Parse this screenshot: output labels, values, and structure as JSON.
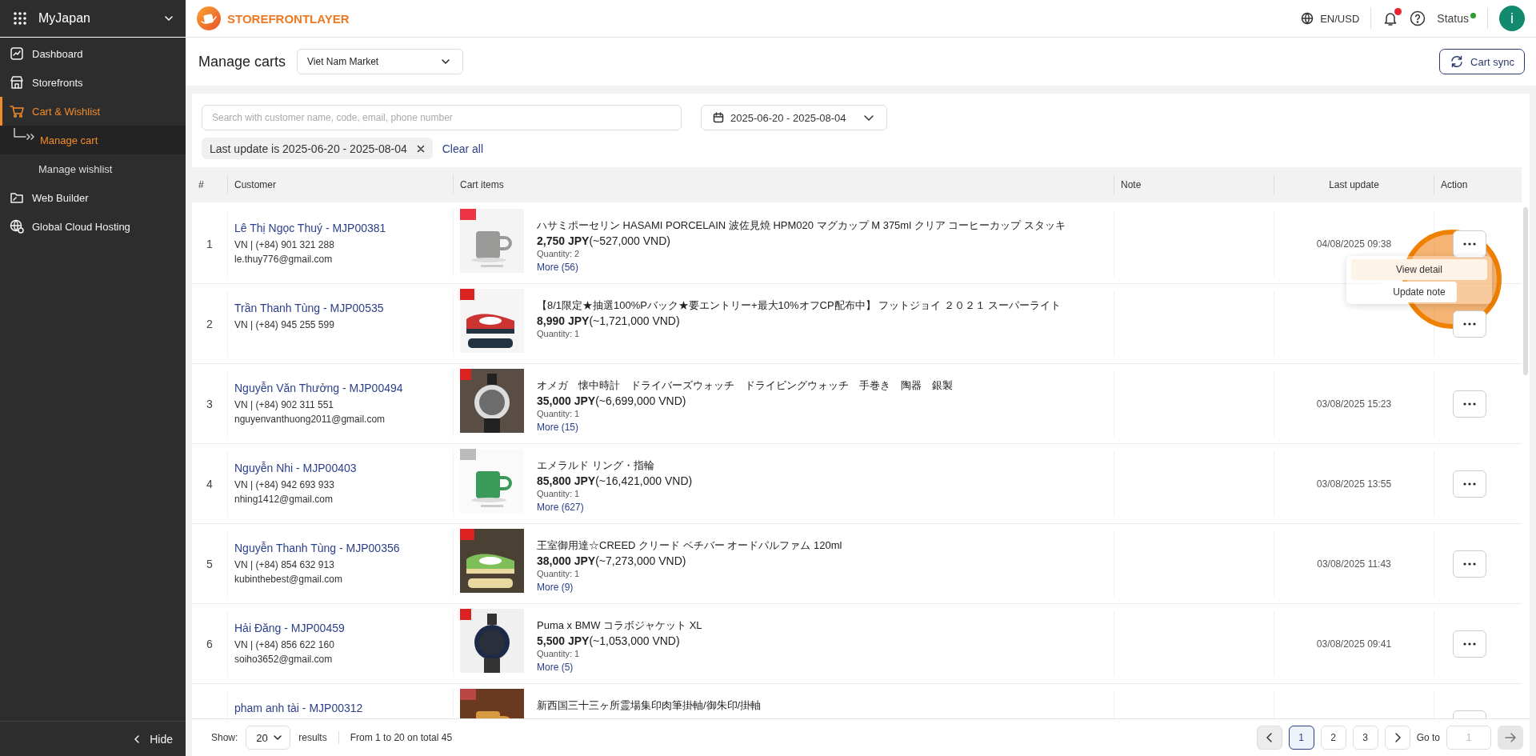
{
  "workspace": {
    "name": "MyJapan"
  },
  "sidebar": {
    "items": [
      {
        "label": "Dashboard",
        "selected": false
      },
      {
        "label": "Storefronts",
        "selected": false
      },
      {
        "label": "Cart & Wishlist",
        "selected": true,
        "children": [
          {
            "label": "Manage cart",
            "selected": true
          },
          {
            "label": "Manage wishlist",
            "selected": false
          }
        ]
      },
      {
        "label": "Web Builder",
        "selected": false
      },
      {
        "label": "Global Cloud Hosting",
        "selected": false
      }
    ],
    "hide_label": "Hide"
  },
  "topbar": {
    "brand": "STOREFRONTLAYER",
    "locale": "EN/USD",
    "notifications_unread": true,
    "status": {
      "label": "Status",
      "online": true
    },
    "avatar": "i"
  },
  "header": {
    "title": "Manage carts",
    "market": "Viet Nam Market",
    "sync_button": "Cart sync"
  },
  "filters": {
    "search_placeholder": "Search with customer name, code, email, phone number",
    "date_range": "2025-06-20 - 2025-08-04",
    "chips": [
      {
        "label": "Last update is 2025-06-20 - 2025-08-04"
      }
    ],
    "clear_all": "Clear all"
  },
  "table": {
    "columns": [
      "#",
      "Customer",
      "Cart items",
      "Note",
      "Last update",
      "Action"
    ],
    "rows": [
      {
        "number": "1",
        "name": "Lê Thị Ngọc Thuý - MJP00381",
        "contact": "VN | (+84) 901 321 288",
        "email": "le.thuy776@gmail.com",
        "item": "ハサミポーセリン HASAMI PORCELAIN 波佐見焼 HPM020 マグカップ M 375ml クリア コーヒーカップ スタッキ",
        "price": "2,750 JPY",
        "converted": "(~527,000 VND)",
        "quantity": "Quantity: 2",
        "more": "More (56)",
        "last_update": "04/08/2025 09:38"
      },
      {
        "number": "2",
        "name": "Trần Thanh Tùng - MJP00535",
        "contact": "VN | (+84) 945 255 599",
        "item": "【8/1限定★抽選100%Pバック★要エントリー+最大10%オフCP配布中】 フットジョイ ２０２１ スーパーライト",
        "price": "8,990 JPY",
        "converted": "(~1,721,000 VND)",
        "quantity": "Quantity: 1"
      },
      {
        "number": "3",
        "name": "Nguyễn Văn Thưởng - MJP00494",
        "contact": "VN | (+84) 902 311 551",
        "email": "nguyenvanthuong2011@gmail.com",
        "item": "オメガ　懐中時計　ドライバーズウォッチ　ドライビングウォッチ　手巻き　陶器　銀製",
        "price": "35,000 JPY",
        "converted": "(~6,699,000 VND)",
        "quantity": "Quantity: 1",
        "more": "More (15)",
        "last_update": "03/08/2025 15:23"
      },
      {
        "number": "4",
        "name": "Nguyễn Nhi - MJP00403",
        "contact": "VN | (+84) 942 693 933",
        "email": "nhing1412@gmail.com",
        "item": "エメラルド リング・指輪",
        "price": "85,800 JPY",
        "converted": "(~16,421,000 VND)",
        "quantity": "Quantity: 1",
        "more": "More (627)",
        "last_update": "03/08/2025 13:55"
      },
      {
        "number": "5",
        "name": "Nguyễn Thanh Tùng - MJP00356",
        "contact": "VN | (+84) 854 632 913",
        "email": "kubinthebest@gmail.com",
        "item": "王室御用達☆CREED クリード ベチバー オードパルファム 120ml",
        "price": "38,000 JPY",
        "converted": "(~7,273,000 VND)",
        "quantity": "Quantity: 1",
        "more": "More (9)",
        "last_update": "03/08/2025 11:43"
      },
      {
        "number": "6",
        "name": "Hải Đăng - MJP00459",
        "contact": "VN | (+84) 856 622 160",
        "email": "soiho3652@gmail.com",
        "item": "Puma x BMW コラボジャケット XL",
        "price": "5,500 JPY",
        "converted": "(~1,053,000 VND)",
        "quantity": "Quantity: 1",
        "more": "More (5)",
        "last_update": "03/08/2025 09:41"
      },
      {
        "name": "pham anh tài - MJP00312",
        "item": "新西国三十三ヶ所霊場集印肉筆掛軸/御朱印/掛軸"
      }
    ]
  },
  "action_menu": {
    "items": [
      {
        "label": "View detail",
        "selected": true
      },
      {
        "label": "Update note",
        "selected": false
      }
    ]
  },
  "footer": {
    "show_label": "Show:",
    "page_size": "20",
    "results_label": "results",
    "summary": "From 1 to 20 on total 45",
    "pages": [
      {
        "label": "1",
        "selected": true
      },
      {
        "label": "2",
        "selected": false
      },
      {
        "label": "3",
        "selected": false
      }
    ],
    "goto_label": "Go to",
    "goto_placeholder": "1"
  }
}
